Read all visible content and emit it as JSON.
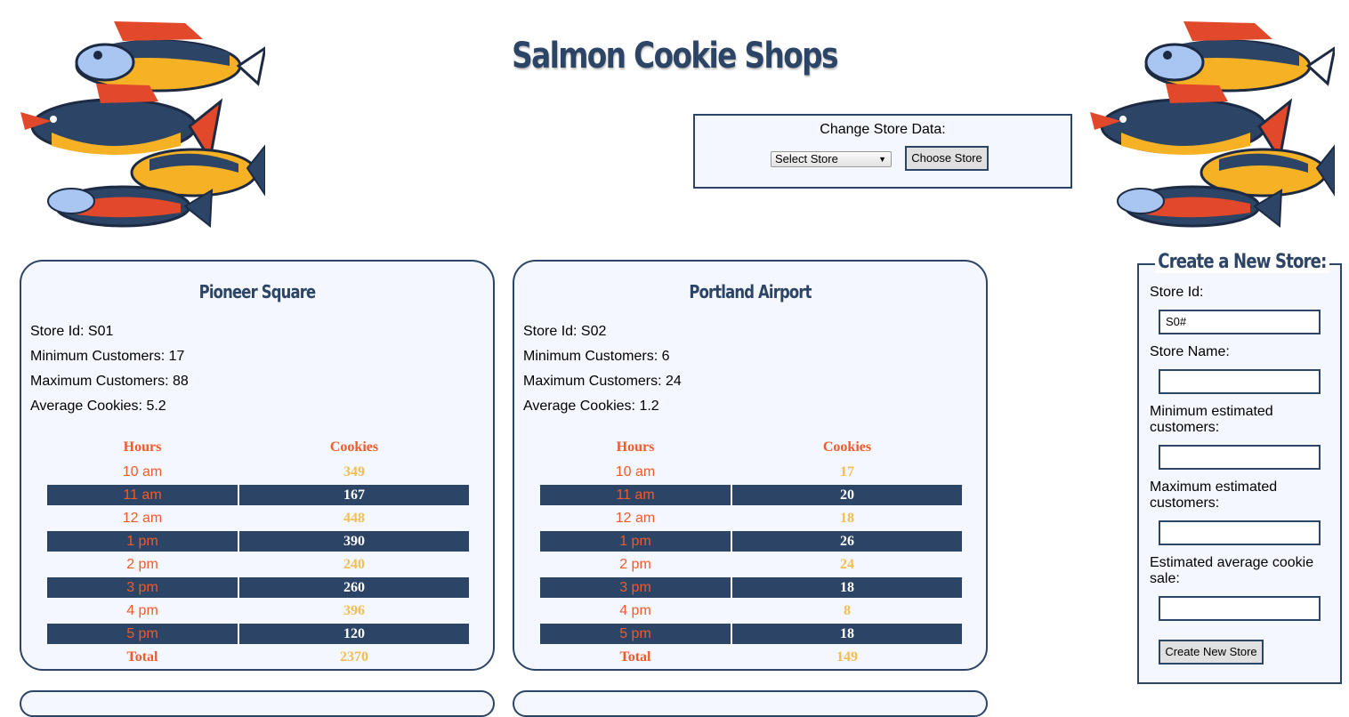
{
  "page": {
    "title": "Salmon Cookie Shops"
  },
  "change_store": {
    "label": "Change Store Data:",
    "select_value": "Select Store",
    "button_label": "Choose Store"
  },
  "stores": [
    {
      "name": "Pioneer Square",
      "id_line": "Store Id: S01",
      "min_line": "Minimum Customers: 17",
      "max_line": "Maximum Customers: 88",
      "avg_line": "Average Cookies: 5.2",
      "headers": {
        "hours": "Hours",
        "cookies": "Cookies"
      },
      "rows": [
        {
          "hour": "10 am",
          "cookies": "349"
        },
        {
          "hour": "11 am",
          "cookies": "167"
        },
        {
          "hour": "12 am",
          "cookies": "448"
        },
        {
          "hour": "1 pm",
          "cookies": "390"
        },
        {
          "hour": "2 pm",
          "cookies": "240"
        },
        {
          "hour": "3 pm",
          "cookies": "260"
        },
        {
          "hour": "4 pm",
          "cookies": "396"
        },
        {
          "hour": "5 pm",
          "cookies": "120"
        }
      ],
      "total_label": "Total",
      "total": "2370"
    },
    {
      "name": "Portland Airport",
      "id_line": "Store Id: S02",
      "min_line": "Minimum Customers: 6",
      "max_line": "Maximum Customers: 24",
      "avg_line": "Average Cookies: 1.2",
      "headers": {
        "hours": "Hours",
        "cookies": "Cookies"
      },
      "rows": [
        {
          "hour": "10 am",
          "cookies": "17"
        },
        {
          "hour": "11 am",
          "cookies": "20"
        },
        {
          "hour": "12 am",
          "cookies": "18"
        },
        {
          "hour": "1 pm",
          "cookies": "26"
        },
        {
          "hour": "2 pm",
          "cookies": "24"
        },
        {
          "hour": "3 pm",
          "cookies": "18"
        },
        {
          "hour": "4 pm",
          "cookies": "8"
        },
        {
          "hour": "5 pm",
          "cookies": "18"
        }
      ],
      "total_label": "Total",
      "total": "149"
    }
  ],
  "new_store_form": {
    "legend": "Create a New Store:",
    "store_id_label": "Store Id:",
    "store_id_value": "S0#",
    "store_name_label": "Store Name:",
    "min_label": "Minimum estimated customers:",
    "max_label": "Maximum estimated customers:",
    "avg_label": "Estimated average cookie sale:",
    "submit_label": "Create New Store"
  },
  "colors": {
    "navy": "#2c4466",
    "orange": "#f15a2b",
    "gold": "#f2be52",
    "panel": "#f4f7fd"
  }
}
